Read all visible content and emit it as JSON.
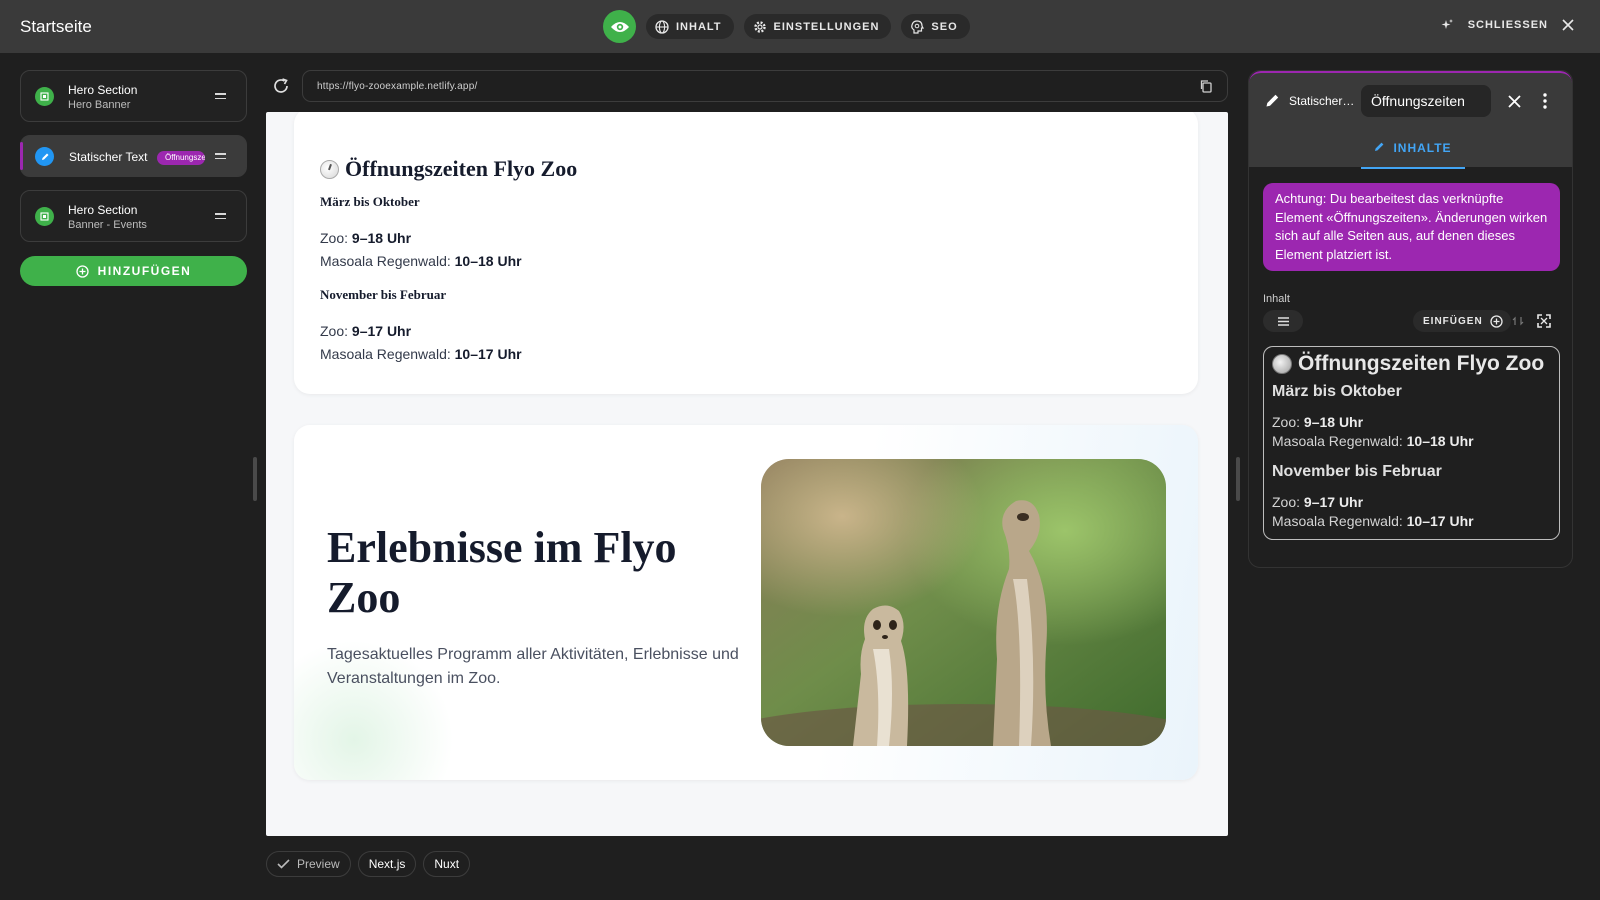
{
  "app": {
    "title": "Startseite"
  },
  "topbar": {
    "tabs": [
      {
        "label": "INHALT",
        "icon": "globe-icon"
      },
      {
        "label": "EINSTELLUNGEN",
        "icon": "gear-icon"
      },
      {
        "label": "SEO",
        "icon": "seo-icon"
      }
    ],
    "close_label": "SCHLIESSEN",
    "accent_color": "#3fb14a"
  },
  "sidebar": {
    "items": [
      {
        "title": "Hero Section",
        "subtitle": "Hero Banner",
        "status": "green"
      },
      {
        "title": "Statischer Text",
        "badge": "Öffnungszeiten",
        "status": "blue",
        "active": true
      },
      {
        "title": "Hero Section",
        "subtitle": "Banner - Events",
        "status": "green"
      }
    ],
    "add_label": "HINZUFÜGEN"
  },
  "preview": {
    "url": "https://flyo-zooexample.netlify.app/",
    "hours": {
      "title": "Öffnungszeiten Flyo Zoo",
      "season1": "März bis Oktober",
      "season1_zoo_label": "Zoo:",
      "season1_zoo_value": "9–18 Uhr",
      "season1_masoala_label": "Masoala Regenwald:",
      "season1_masoala_value": "10–18 Uhr",
      "season2": "November bis Februar",
      "season2_zoo_label": "Zoo:",
      "season2_zoo_value": "9–17 Uhr",
      "season2_masoala_label": "Masoala Regenwald:",
      "season2_masoala_value": "10–17 Uhr"
    },
    "hero": {
      "title": "Erlebnisse im Flyo Zoo",
      "text": "Tagesaktuelles Programm aller Aktivitäten, Erlebnisse und Veranstaltungen im Zoo."
    },
    "frameworks": [
      "Preview",
      "Next.js",
      "Nuxt"
    ]
  },
  "panel": {
    "breadcrumb": "Statischer ...",
    "element_name": "Öffnungszeiten",
    "tab_label": "INHALTE",
    "warning": "Achtung: Du bearbeitest das verknüpfte Element «Öffnungszeiten». Änderungen wirken sich auf alle Seiten aus, auf denen dieses Element platziert ist.",
    "content_label": "Inhalt",
    "insert_label": "EINFÜGEN",
    "accent_color": "#9c27b0"
  }
}
